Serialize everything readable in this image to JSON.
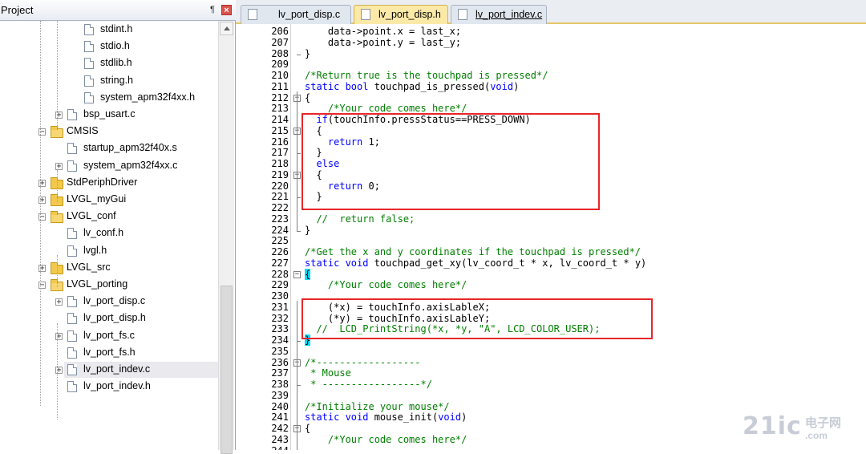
{
  "project_panel": {
    "title": "Project",
    "pin_glyph": "¶",
    "close_glyph": "×",
    "tree": [
      {
        "label": "stdint.h",
        "kind": "file",
        "level": 2
      },
      {
        "label": "stdio.h",
        "kind": "file",
        "level": 2
      },
      {
        "label": "stdlib.h",
        "kind": "file",
        "level": 2
      },
      {
        "label": "string.h",
        "kind": "file",
        "level": 2
      },
      {
        "label": "system_apm32f4xx.h",
        "kind": "file",
        "level": 2
      },
      {
        "label": "bsp_usart.c",
        "kind": "file",
        "level": 1,
        "expander": "+"
      },
      {
        "label": "CMSIS",
        "kind": "folder-open",
        "level": 0,
        "expander": "−"
      },
      {
        "label": "startup_apm32f40x.s",
        "kind": "file",
        "level": 1
      },
      {
        "label": "system_apm32f4xx.c",
        "kind": "file",
        "level": 1,
        "expander": "+"
      },
      {
        "label": "StdPeriphDriver",
        "kind": "folder",
        "level": 0,
        "expander": "+"
      },
      {
        "label": "LVGL_myGui",
        "kind": "folder",
        "level": 0,
        "expander": "+"
      },
      {
        "label": "LVGL_conf",
        "kind": "folder-open",
        "level": 0,
        "expander": "−"
      },
      {
        "label": "lv_conf.h",
        "kind": "file",
        "level": 1
      },
      {
        "label": "lvgl.h",
        "kind": "file",
        "level": 1
      },
      {
        "label": "LVGL_src",
        "kind": "folder",
        "level": 0,
        "expander": "+"
      },
      {
        "label": "LVGL_porting",
        "kind": "folder-open",
        "level": 0,
        "expander": "−"
      },
      {
        "label": "lv_port_disp.c",
        "kind": "file",
        "level": 1,
        "expander": "+"
      },
      {
        "label": "lv_port_disp.h",
        "kind": "file",
        "level": 1
      },
      {
        "label": "lv_port_fs.c",
        "kind": "file",
        "level": 1,
        "expander": "+"
      },
      {
        "label": "lv_port_fs.h",
        "kind": "file",
        "level": 1
      },
      {
        "label": "lv_port_indev.c",
        "kind": "file",
        "level": 1,
        "expander": "+",
        "selected": true
      },
      {
        "label": "lv_port_indev.h",
        "kind": "file",
        "level": 1
      }
    ]
  },
  "tabs": [
    {
      "label": "lv_port_disp.c"
    },
    {
      "label": "lv_port_disp.h"
    },
    {
      "label": "lv_port_indev.c"
    }
  ],
  "editor": {
    "lines": [
      {
        "num": "206",
        "text": "    data->point.x = last_x;",
        "style": "plain"
      },
      {
        "num": "207",
        "text": "    data->point.y = last_y;",
        "style": "plain"
      },
      {
        "num": "208",
        "text": "}",
        "style": "plain",
        "fold": "end"
      },
      {
        "num": "209",
        "text": "",
        "style": "plain"
      },
      {
        "num": "210",
        "text": "/*Return true is the touchpad is pressed*/",
        "style": "comment"
      },
      {
        "num": "211",
        "text": "static bool touchpad_is_pressed(void)",
        "style": "keyword"
      },
      {
        "num": "212",
        "text": "{",
        "style": "plain",
        "fold": "open"
      },
      {
        "num": "213",
        "text": "    /*Your code comes here*/",
        "style": "comment"
      },
      {
        "num": "214",
        "text": "  if(touchInfo.pressStatus==PRESS_DOWN)",
        "style": "plain"
      },
      {
        "num": "215",
        "text": "  {",
        "style": "plain",
        "fold": "open"
      },
      {
        "num": "216",
        "text": "    return 1;",
        "style": "plain"
      },
      {
        "num": "217",
        "text": "  }",
        "style": "plain",
        "fold": "end"
      },
      {
        "num": "218",
        "text": "  else",
        "style": "plain"
      },
      {
        "num": "219",
        "text": "  {",
        "style": "plain",
        "fold": "open"
      },
      {
        "num": "220",
        "text": "    return 0;",
        "style": "plain"
      },
      {
        "num": "221",
        "text": "  }",
        "style": "plain",
        "fold": "end"
      },
      {
        "num": "222",
        "text": "",
        "style": "plain"
      },
      {
        "num": "223",
        "text": "  //  return false;",
        "style": "comment"
      },
      {
        "num": "224",
        "text": "}",
        "style": "plain",
        "fold": "end"
      },
      {
        "num": "225",
        "text": "",
        "style": "plain"
      },
      {
        "num": "226",
        "text": "/*Get the x and y coordinates if the touchpad is pressed*/",
        "style": "comment"
      },
      {
        "num": "227",
        "text": "static void touchpad_get_xy(lv_coord_t * x, lv_coord_t * y)",
        "style": "keyword"
      },
      {
        "num": "228",
        "text": "{",
        "style": "cursor",
        "fold": "open"
      },
      {
        "num": "229",
        "text": "    /*Your code comes here*/",
        "style": "comment"
      },
      {
        "num": "230",
        "text": "",
        "style": "plain"
      },
      {
        "num": "231",
        "text": "    (*x) = touchInfo.axisLableX;",
        "style": "plain"
      },
      {
        "num": "232",
        "text": "    (*y) = touchInfo.axisLableY;",
        "style": "plain"
      },
      {
        "num": "233",
        "text": "  //  LCD_PrintString(*x, *y, \"A\", LCD_COLOR_USER);",
        "style": "comment"
      },
      {
        "num": "234",
        "text": "}",
        "style": "cursor",
        "fold": "end"
      },
      {
        "num": "235",
        "text": "",
        "style": "plain"
      },
      {
        "num": "236",
        "text": "/*------------------",
        "style": "comment",
        "fold": "open"
      },
      {
        "num": "237",
        "text": " * Mouse",
        "style": "comment"
      },
      {
        "num": "238",
        "text": " * -----------------*/",
        "style": "comment",
        "fold": "end"
      },
      {
        "num": "239",
        "text": "",
        "style": "plain"
      },
      {
        "num": "240",
        "text": "/*Initialize your mouse*/",
        "style": "comment"
      },
      {
        "num": "241",
        "text": "static void mouse_init(void)",
        "style": "keyword"
      },
      {
        "num": "242",
        "text": "{",
        "style": "plain",
        "fold": "open"
      },
      {
        "num": "243",
        "text": "    /*Your code comes here*/",
        "style": "comment"
      },
      {
        "num": "244",
        "text": "",
        "style": "plain"
      }
    ]
  },
  "watermark": {
    "brand": "21ic",
    "cn": "电子网",
    "sub": ".com"
  },
  "colors": {
    "comment": "#007f00",
    "keyword": "#0000ff",
    "highlight_box": "#e8262a",
    "active_tab": "#fbe9a8"
  }
}
